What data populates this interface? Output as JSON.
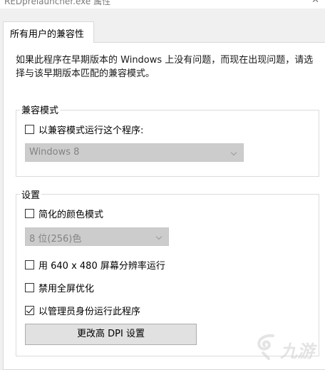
{
  "window": {
    "title": "REDprelauncher.exe 属性"
  },
  "tabs": [
    {
      "label": "所有用户的兼容性",
      "active": true
    }
  ],
  "description": "如果此程序在早期版本的 Windows 上没有问题，而现在出现问题，请选择与该早期版本匹配的兼容模式。",
  "compat_mode": {
    "group_label": "兼容模式",
    "checkbox_label": "以兼容模式运行这个程序:",
    "checked": false,
    "select_value": "Windows 8",
    "select_enabled": false
  },
  "settings": {
    "group_label": "设置",
    "reduced_color": {
      "label": "简化的颜色模式",
      "checked": false
    },
    "color_select_value": "8 位(256)色",
    "run_640": {
      "label": "用 640 x 480 屏幕分辨率运行",
      "checked": false
    },
    "disable_fullscreen_opt": {
      "label": "禁用全屏优化",
      "checked": false
    },
    "run_as_admin": {
      "label": "以管理员身份运行此程序",
      "checked": true
    },
    "dpi_button_label": "更改高 DPI 设置"
  },
  "watermark": {
    "text": "九游"
  },
  "colors": {
    "disabled_select_bg": "#cccccc",
    "panel_bg": "#ffffff",
    "window_bg": "#f0f0f0"
  }
}
